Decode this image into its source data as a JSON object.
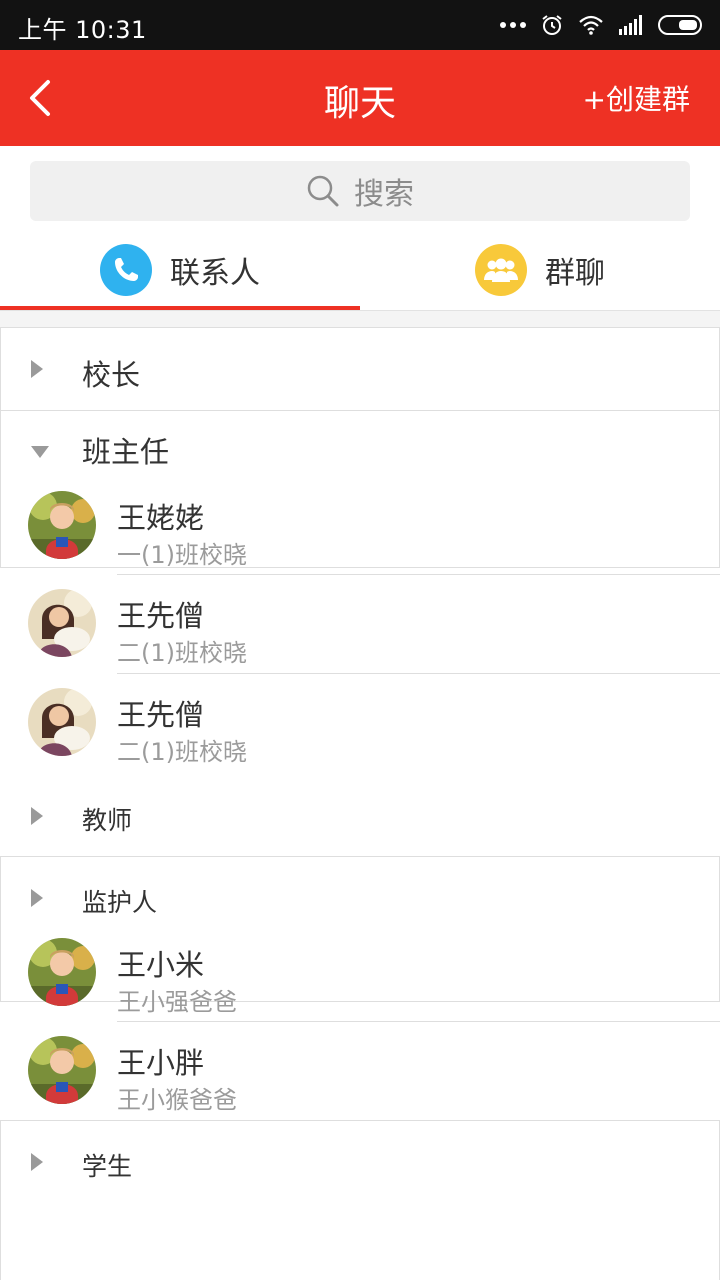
{
  "status_bar": {
    "time": "上午 10:31"
  },
  "app_bar": {
    "title": "聊天",
    "create_group": "+创建群"
  },
  "search": {
    "placeholder": "搜索"
  },
  "tabs": [
    {
      "label": "联系人",
      "icon": "phone-icon",
      "color": "#2fb2ef"
    },
    {
      "label": "群聊",
      "icon": "group-icon",
      "color": "#f8c93a"
    }
  ],
  "accent_color": "#ee3124",
  "groups": [
    {
      "name": "校长",
      "expanded": false
    },
    {
      "name": "班主任",
      "expanded": true,
      "contacts": [
        {
          "name": "王姥姥",
          "sub": "一(1)班校晓"
        },
        {
          "name": "王先僧",
          "sub": "二(1)班校晓"
        },
        {
          "name": "王先僧",
          "sub": "二(1)班校晓"
        }
      ]
    },
    {
      "name": "教师",
      "expanded": false
    },
    {
      "name": "监护人",
      "expanded": true,
      "contacts": [
        {
          "name": "王小米",
          "sub": "王小强爸爸"
        },
        {
          "name": "王小胖",
          "sub": "王小猴爸爸"
        }
      ]
    },
    {
      "name": "学生",
      "expanded": false
    }
  ]
}
